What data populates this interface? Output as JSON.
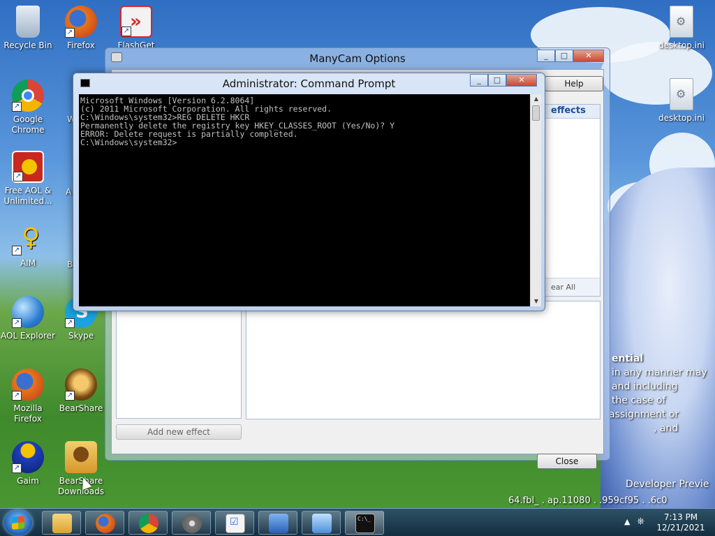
{
  "desktop": {
    "icons": [
      {
        "label": "Recycle Bin",
        "icon": "recycle-bin-icon",
        "color": "#c8d8e8"
      },
      {
        "label": "Firefox",
        "icon": "firefox-icon",
        "color": "#e8751a"
      },
      {
        "label": "FlashGet",
        "icon": "flashget-icon",
        "color": "#d8262c"
      },
      {
        "label": "Google Chrome",
        "icon": "chrome-icon",
        "color": "#3b8ae0"
      },
      {
        "label": "Free AOL & Unlimited...",
        "icon": "aol-free-icon",
        "color": "#c8281e"
      },
      {
        "label": "AIM",
        "icon": "aim-icon",
        "color": "#f5c400"
      },
      {
        "label": "AOL Explorer",
        "icon": "aol-explorer-icon",
        "color": "#2d7dd2"
      },
      {
        "label": "Skype",
        "icon": "skype-icon",
        "color": "#1ba3e0"
      },
      {
        "label": "Mozilla Firefox",
        "icon": "firefox-icon",
        "color": "#e8751a"
      },
      {
        "label": "BearShare",
        "icon": "bearshare-icon",
        "color": "#7a4a12"
      },
      {
        "label": "Gaim",
        "icon": "gaim-icon",
        "color": "#1d3fbf"
      },
      {
        "label": "BearShare Downloads",
        "icon": "bearshare-folder-icon",
        "color": "#e0a83a"
      },
      {
        "label": "desktop.ini",
        "icon": "ini-file-icon",
        "color": "#dfe6ee"
      },
      {
        "label": "desktop.ini",
        "icon": "ini-file-icon",
        "color": "#dfe6ee"
      }
    ],
    "partial_labels": {
      "w": "W",
      "a": "A",
      "b": "B"
    },
    "wallpaper_text": {
      "line1": "ential",
      "line2": "in any manner may",
      "line3": "and including",
      "line4": "the case of",
      "line5": "assignment or",
      "line6": ", and",
      "build1": "Developer Previe",
      "build2": "64.fbl_ . ap.11080 . .959cf95 . .6c0"
    }
  },
  "manycam": {
    "title": "ManyCam Options",
    "help_label": "Help",
    "effects_label": "effects",
    "clear_all_label": "ear All",
    "add_effect_label": "Add new effect",
    "close_label": "Close"
  },
  "cmd": {
    "title": "Administrator: Command Prompt",
    "lines": [
      "Microsoft Windows [Version 6.2.8064]",
      "(c) 2011 Microsoft Corporation. All rights reserved.",
      "",
      "C:\\Windows\\system32>REG DELETE HKCR",
      "Permanently delete the registry key HKEY_CLASSES_ROOT (Yes/No)? Y",
      "ERROR: Delete request is partially completed.",
      "",
      "C:\\Windows\\system32>"
    ]
  },
  "taskbar": {
    "items": [
      {
        "name": "explorer",
        "icon": "folder-icon",
        "color": "#e8c04a"
      },
      {
        "name": "firefox",
        "icon": "firefox-icon",
        "color": "#e8751a"
      },
      {
        "name": "chrome",
        "icon": "chrome-icon",
        "color": "#3b8ae0"
      },
      {
        "name": "media",
        "icon": "film-reel-icon",
        "color": "#8a8a8a"
      },
      {
        "name": "tasks",
        "icon": "checklist-icon",
        "color": "#f2f2f2"
      },
      {
        "name": "network",
        "icon": "network-icon",
        "color": "#3a6fd0"
      },
      {
        "name": "control",
        "icon": "control-panel-icon",
        "color": "#5fa0e0"
      },
      {
        "name": "cmd",
        "icon": "cmd-icon",
        "color": "#111111"
      }
    ],
    "cmd_icon_text": "C:\\_",
    "time": "7:13 PM",
    "date": "12/21/2021"
  }
}
